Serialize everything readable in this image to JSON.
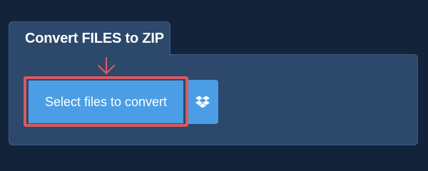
{
  "panel": {
    "title": "Convert FILES to ZIP"
  },
  "buttons": {
    "select_files_label": "Select files to convert",
    "dropbox_icon": "dropbox-icon"
  },
  "colors": {
    "background": "#12233a",
    "panel": "#2c486a",
    "button": "#4b9ee5",
    "highlight": "#d9595f"
  }
}
